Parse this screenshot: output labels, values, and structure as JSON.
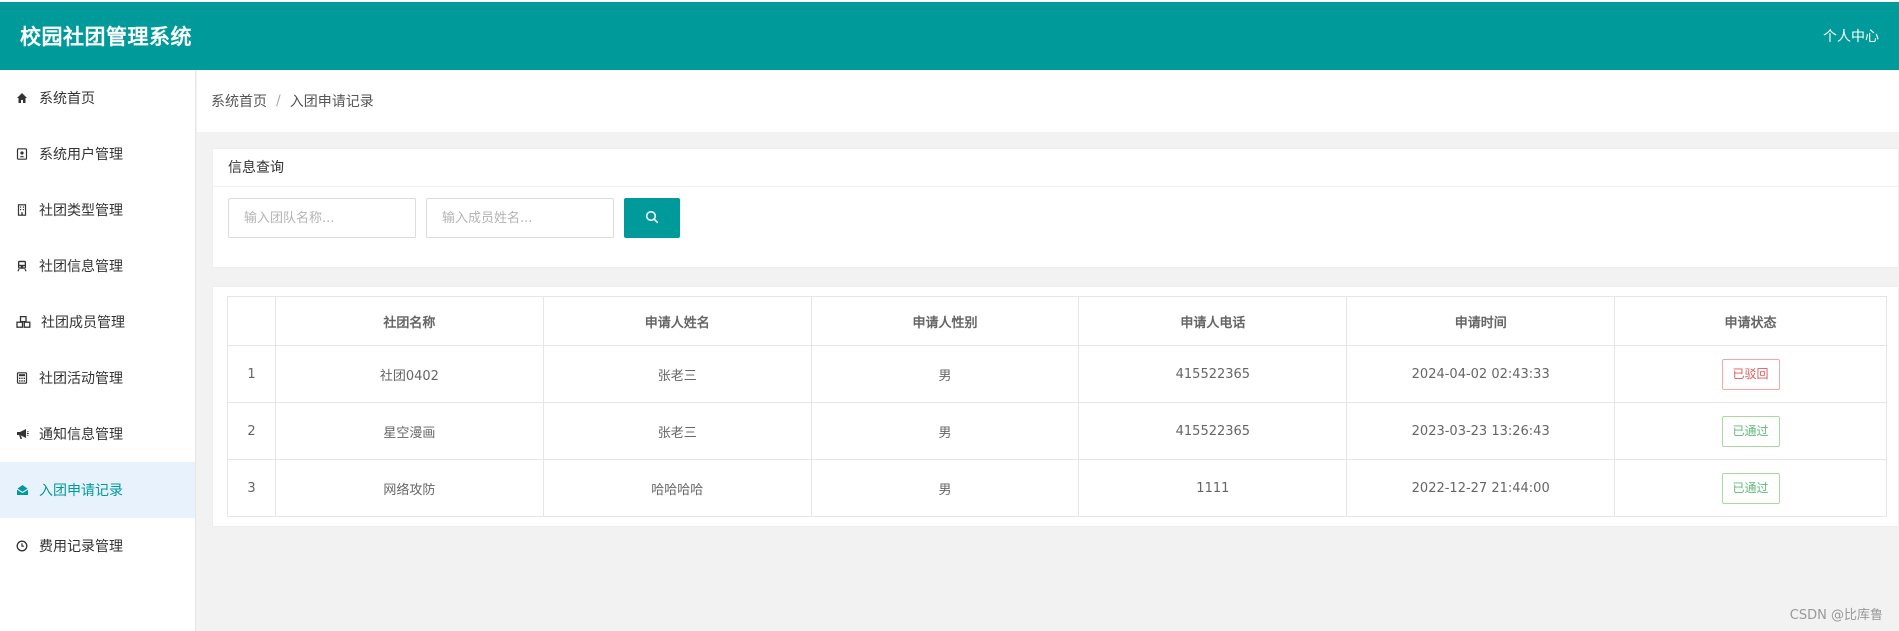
{
  "header": {
    "brand": "校园社团管理系统",
    "user_center": "个人中心",
    "color": "#009a9a"
  },
  "sidebar": {
    "items": [
      {
        "label": "系统首页",
        "icon": "home-icon"
      },
      {
        "label": "系统用户管理",
        "icon": "user-card-icon"
      },
      {
        "label": "社团类型管理",
        "icon": "building-icon"
      },
      {
        "label": "社团信息管理",
        "icon": "train-icon"
      },
      {
        "label": "社团成员管理",
        "icon": "cubes-icon"
      },
      {
        "label": "社团活动管理",
        "icon": "calculator-icon"
      },
      {
        "label": "通知信息管理",
        "icon": "bullhorn-icon"
      },
      {
        "label": "入团申请记录",
        "icon": "envelope-open-icon",
        "active": true
      },
      {
        "label": "费用记录管理",
        "icon": "clock-icon"
      }
    ]
  },
  "breadcrumb": {
    "home": "系统首页",
    "separator": "/",
    "current": "入团申请记录"
  },
  "query": {
    "title": "信息查询",
    "team_placeholder": "输入团队名称...",
    "member_placeholder": "输入成员姓名...",
    "search_icon": "search-icon"
  },
  "table": {
    "headers": [
      "",
      "社团名称",
      "申请人姓名",
      "申请人性别",
      "申请人电话",
      "申请时间",
      "申请状态"
    ],
    "rows": [
      {
        "index": "1",
        "club": "社团0402",
        "name": "张老三",
        "gender": "男",
        "phone": "415522365",
        "time": "2024-04-02 02:43:33",
        "status": "已驳回",
        "status_type": "reject"
      },
      {
        "index": "2",
        "club": "星空漫画",
        "name": "张老三",
        "gender": "男",
        "phone": "415522365",
        "time": "2023-03-23 13:26:43",
        "status": "已通过",
        "status_type": "pass"
      },
      {
        "index": "3",
        "club": "网络攻防",
        "name": "哈哈哈哈",
        "gender": "男",
        "phone": "1111",
        "time": "2022-12-27 21:44:00",
        "status": "已通过",
        "status_type": "pass"
      }
    ]
  },
  "watermark": "CSDN @比库鲁"
}
